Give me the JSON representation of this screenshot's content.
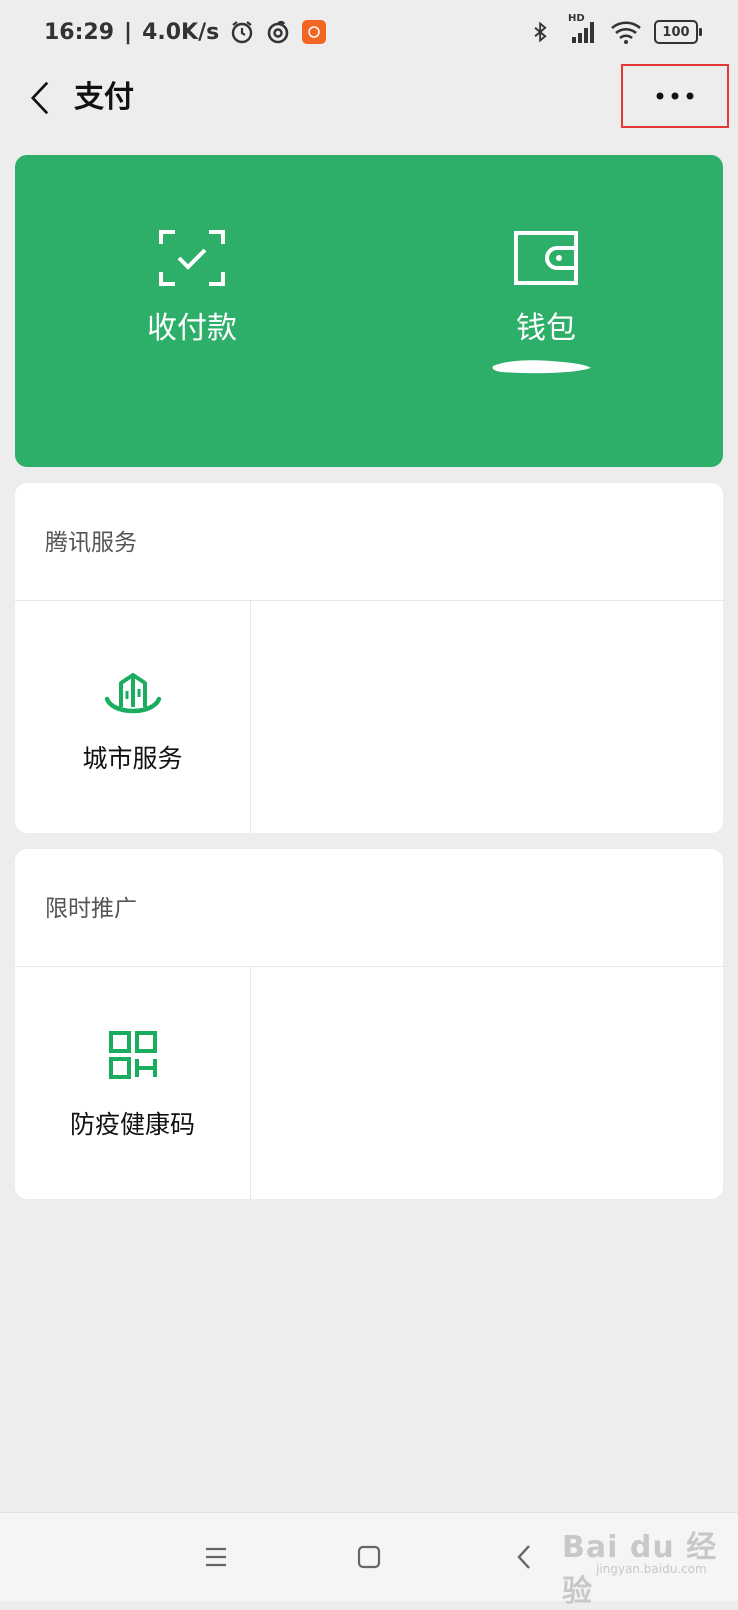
{
  "status_bar": {
    "time": "16:29",
    "separator": "|",
    "net_speed": "4.0K/s",
    "signal_tag": "HD",
    "battery": "100",
    "icons": [
      "alarm-icon",
      "netease-music-icon",
      "mi-app-icon",
      "bluetooth-icon",
      "cellular-signal-icon",
      "wifi-icon",
      "battery-icon"
    ]
  },
  "nav": {
    "title": "支付",
    "back_icon": "chevron-left-icon",
    "more_icon": "more-dots-icon"
  },
  "pay_card": {
    "color": "#2daf69",
    "items": [
      {
        "label": "收付款",
        "icon": "scan-check-icon"
      },
      {
        "label": "钱包",
        "icon": "wallet-icon"
      }
    ]
  },
  "sections": [
    {
      "title": "腾讯服务",
      "items": [
        {
          "label": "城市服务",
          "icon": "city-services-icon"
        }
      ]
    },
    {
      "title": "限时推广",
      "items": [
        {
          "label": "防疫健康码",
          "icon": "health-code-icon"
        }
      ]
    }
  ],
  "system_nav": {
    "buttons": [
      "menu-icon",
      "home-icon",
      "back-icon"
    ]
  },
  "watermark": {
    "brand": "Bai du 经验",
    "url": "jingyan.baidu.com"
  },
  "colors": {
    "accent_green": "#2daf69",
    "icon_green": "#1aad5f",
    "highlight_red": "#e53935",
    "background": "#ededed"
  }
}
